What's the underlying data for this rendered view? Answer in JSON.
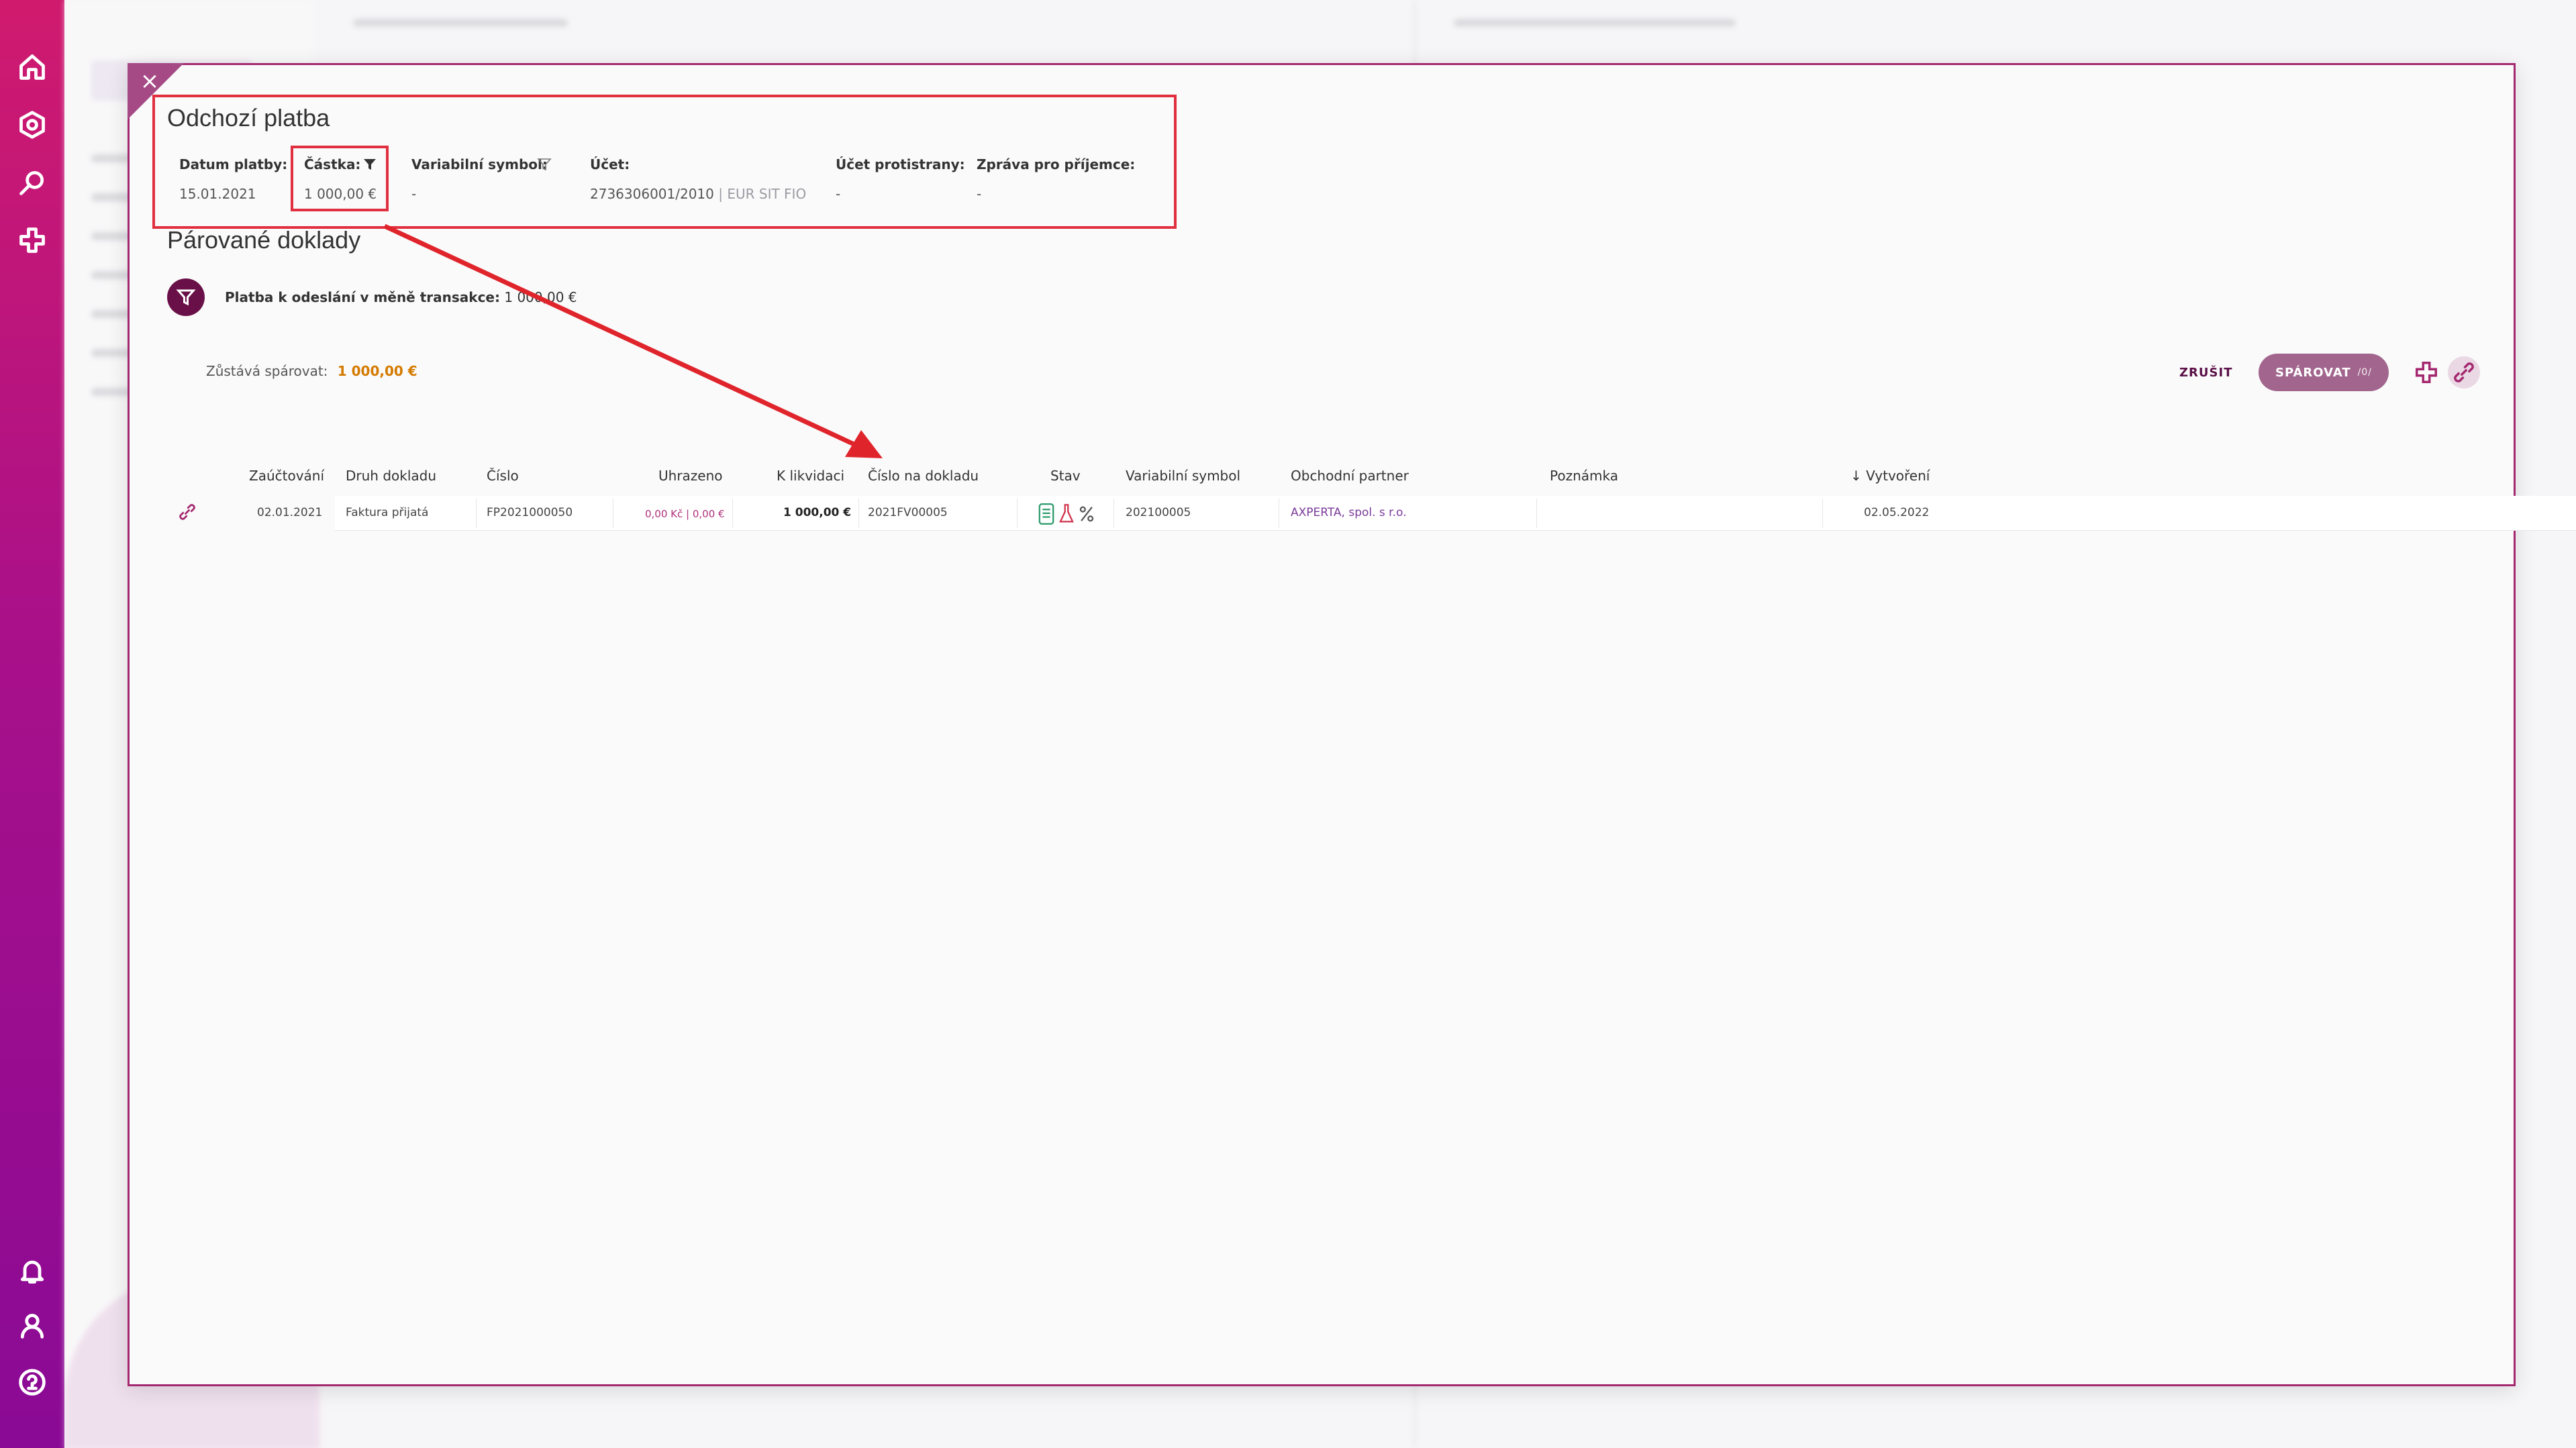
{
  "modal": {
    "close_label": "×",
    "title": "Odchozí platba",
    "payment_info": {
      "date_label": "Datum platby:",
      "date_value": "15.01.2021",
      "amount_label": "Částka:",
      "amount_value": "1 000,00 €",
      "vs_label": "Variabilní symbol:",
      "vs_value": "-",
      "account_label": "Účet:",
      "account_value": "2736306001/2010",
      "account_suffix": "| EUR SIT FIO",
      "counter_label": "Účet protistrany:",
      "counter_value": "-",
      "message_label": "Zpráva pro příjemce:",
      "message_value": "-"
    },
    "paired_title": "Párované doklady",
    "filter": {
      "label": "Platba k odeslání v měně transakce:",
      "value": "1 000,00 €"
    },
    "remaining": {
      "label": "Zůstává spárovat:",
      "value": "1 000,00 €"
    },
    "actions": {
      "cancel": "ZRUŠIT",
      "pair": "SPÁROVAT",
      "pair_count": "/0/"
    },
    "table": {
      "headers": {
        "posting": "Zaúčtování",
        "doc_type": "Druh dokladu",
        "number": "Číslo",
        "paid": "Uhrazeno",
        "to_settle": "K likvidaci",
        "doc_number": "Číslo na dokladu",
        "status": "Stav",
        "vs": "Variabilní symbol",
        "partner": "Obchodní partner",
        "note": "Poznámka",
        "created": "Vytvoření",
        "created_sort": "↓"
      },
      "rows": [
        {
          "posting": "02.01.2021",
          "doc_type": "Faktura přijatá",
          "number": "FP2021000050",
          "paid_czk": "0,00 Kč",
          "paid_eur": "| 0,00 €",
          "to_settle": "1 000,00 €",
          "doc_number": "2021FV00005",
          "vs": "202100005",
          "partner": "AXPERTA, spol. s r.o.",
          "note": "",
          "created": "02.05.2022"
        }
      ]
    }
  },
  "colors": {
    "accent": "#a4286f",
    "highlight": "#e03040",
    "amount_orange": "#d47a00"
  }
}
